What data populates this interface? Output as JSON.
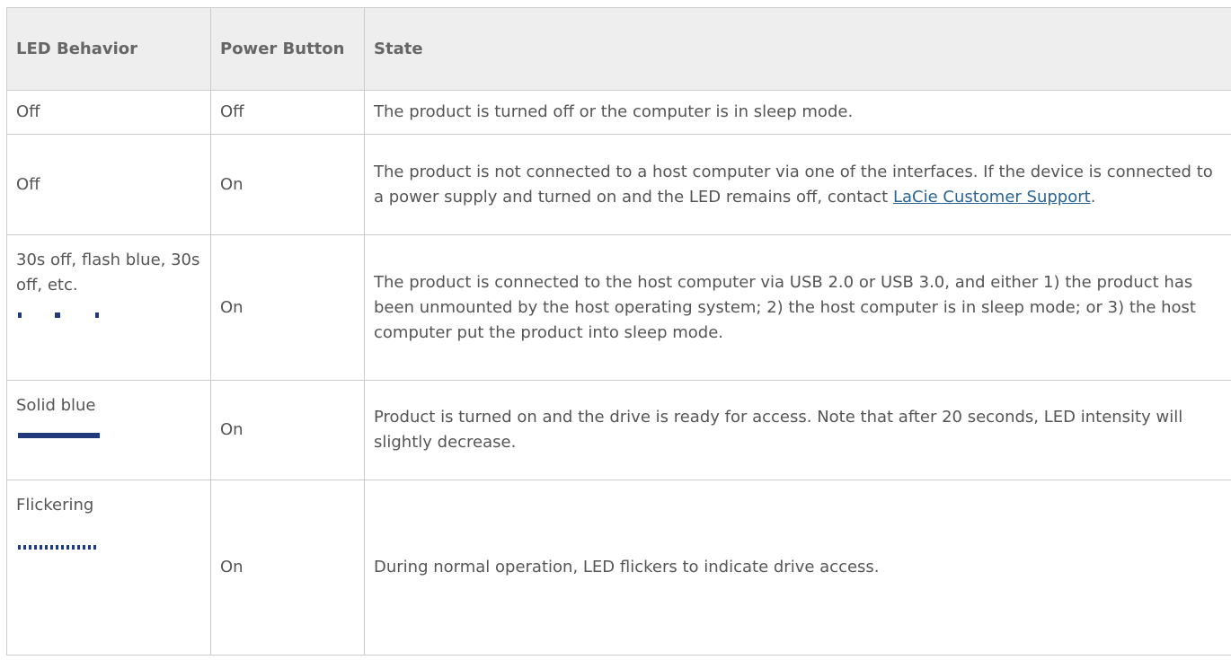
{
  "table": {
    "headers": {
      "led": "LED Behavior",
      "power": "Power Button",
      "state": "State"
    },
    "rows": [
      {
        "led": "Off",
        "power": "Off",
        "state": "The product is turned off or the computer is in sleep mode."
      },
      {
        "led": "Off",
        "power": "On",
        "state_before": "The product is not connected to a host computer via one of the interfaces. If the device is connected to a power supply and turned on and the LED remains off, contact ",
        "state_link": "LaCie Customer Support",
        "state_after": "."
      },
      {
        "led": "30s off, flash blue, 30s off, etc.",
        "led_pattern_icon": "blink-pattern-icon",
        "power": "On",
        "state": "The product is connected to the host computer via USB 2.0 or USB 3.0, and either 1) the product has been unmounted by the host operating system; 2) the host computer is in sleep mode; or 3) the host computer put the product into sleep mode."
      },
      {
        "led": "Solid blue",
        "led_pattern_icon": "solid-pattern-icon",
        "power": "On",
        "state": "Product is turned on and the drive is ready for access. Note that after 20 seconds, LED intensity will slightly decrease."
      },
      {
        "led": "Flickering",
        "led_pattern_icon": "flicker-pattern-icon",
        "power": "On",
        "state": "During normal operation, LED flickers to indicate drive access."
      }
    ]
  },
  "colors": {
    "led_blue": "#233a7a",
    "link": "#2a6496",
    "header_bg": "#eeeeee",
    "border": "#cccccc"
  }
}
